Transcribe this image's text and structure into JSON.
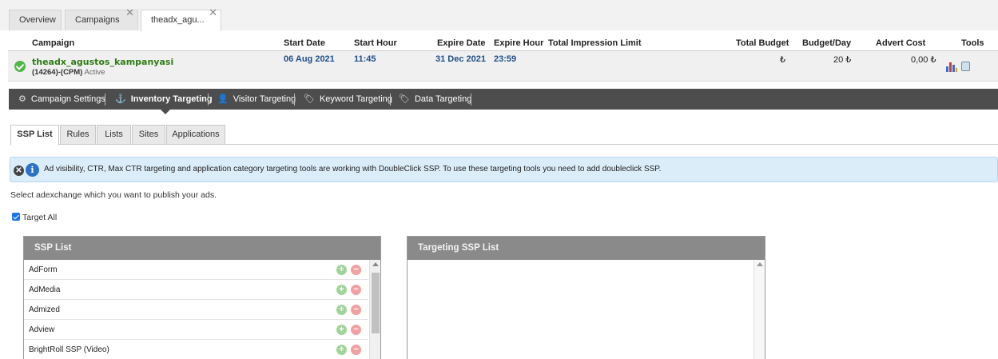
{
  "top_tabs": [
    {
      "label": "Overview"
    },
    {
      "label": "Campaigns",
      "close": "✕"
    },
    {
      "label": "theadx_agu...",
      "close": "✕"
    }
  ],
  "campaign_table": {
    "headers": {
      "campaign": "Campaign",
      "start_date": "Start Date",
      "start_hour": "Start Hour",
      "expire_date": "Expire Date",
      "expire_hour": "Expire Hour",
      "impression_limit": "Total Impression Limit",
      "total_budget": "Total Budget",
      "budget_day": "Budget/Day",
      "advert_cost": "Advert Cost",
      "tools": "Tools"
    },
    "row": {
      "name": "theadx_agustos_kampanyasi",
      "id_model": "(14264)-(CPM)",
      "status": "Active",
      "start_date": "06 Aug 2021",
      "start_hour": "11:45",
      "expire_date": "31 Dec 2021",
      "expire_hour": "23:59",
      "impression_limit": "",
      "total_budget": "₺",
      "budget_day": "20 ₺",
      "advert_cost": "0,00 ₺"
    }
  },
  "targeting_nav": [
    {
      "label": "Campaign Settings",
      "icon": "⚙"
    },
    {
      "label": "Inventory Targeting",
      "icon": "⚓"
    },
    {
      "label": "Visitor Targeting",
      "icon": "👤"
    },
    {
      "label": "Keyword Targeting",
      "icon": "🏷"
    },
    {
      "label": "Data Targeting",
      "icon": "🏷"
    }
  ],
  "sub_tabs": [
    {
      "label": "SSP List"
    },
    {
      "label": "Rules"
    },
    {
      "label": "Lists"
    },
    {
      "label": "Sites"
    },
    {
      "label": "Applications"
    }
  ],
  "info": {
    "close_glyph": "✕",
    "info_glyph": "i",
    "text": "Ad visibility, CTR, Max CTR targeting and application category targeting tools are working with DoubleClick SSP. To use these targeting tools you need to add doubleclick SSP."
  },
  "select_note": "Select adexchange which you want to publish your ads.",
  "target_all": "Target All",
  "ssp_panel": {
    "title": "SSP List",
    "add_glyph": "+",
    "remove_glyph": "−",
    "items": [
      "AdForm",
      "AdMedia",
      "Admized",
      "Adview",
      "BrightRoll SSP (Video)"
    ]
  },
  "targeting_panel": {
    "title": "Targeting SSP List"
  },
  "colors": {
    "nav_bg": "#4d4d4d",
    "campaign_green": "#2e7d12",
    "date_blue": "#1f4f8a",
    "info_bg": "#dcedfa",
    "panel_head": "#8a8a8a"
  }
}
